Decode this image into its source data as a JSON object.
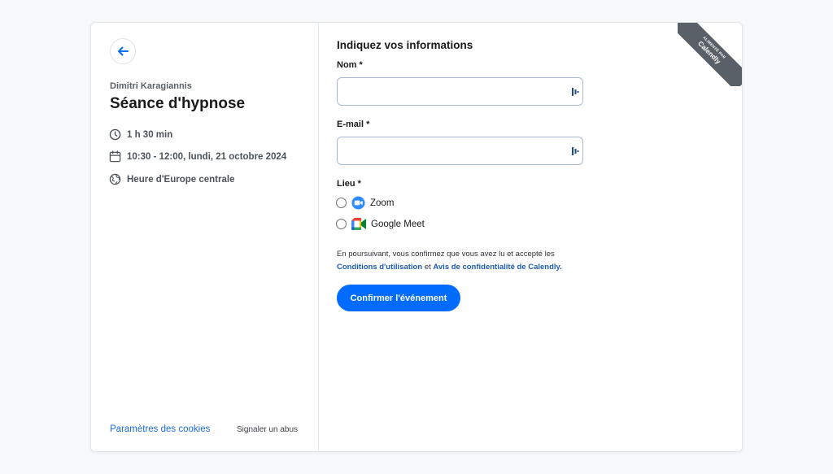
{
  "sidebar": {
    "host_name": "Dimitri Karagiannis",
    "event_title": "Séance d'hypnose",
    "duration": "1 h 30 min",
    "datetime": "10:30 - 12:00, lundi, 21 octobre 2024",
    "timezone": "Heure d'Europe centrale",
    "cookies_link": "Paramètres des cookies",
    "report_link": "Signaler un abus"
  },
  "form": {
    "heading": "Indiquez vos informations",
    "name_label": "Nom *",
    "name_value": "",
    "email_label": "E-mail *",
    "email_value": "",
    "location_label": "Lieu *",
    "options": [
      {
        "label": "Zoom",
        "icon": "zoom-icon"
      },
      {
        "label": "Google Meet",
        "icon": "google-meet-icon"
      }
    ],
    "consent_text": "En poursuivant, vous confirmez que vous avez lu et accepté les",
    "terms_link": "Conditions d'utilisation",
    "consent_and": "et",
    "privacy_link": "Avis de confidentialité de Calendly.",
    "confirm_button": "Confirmer l'événement"
  },
  "badge": {
    "line1": "ALIMENTÉ PAR",
    "line2": "Calendly"
  },
  "colors": {
    "accent": "#006bff",
    "link": "#1c6bd6",
    "ribbon": "#5a6068"
  }
}
